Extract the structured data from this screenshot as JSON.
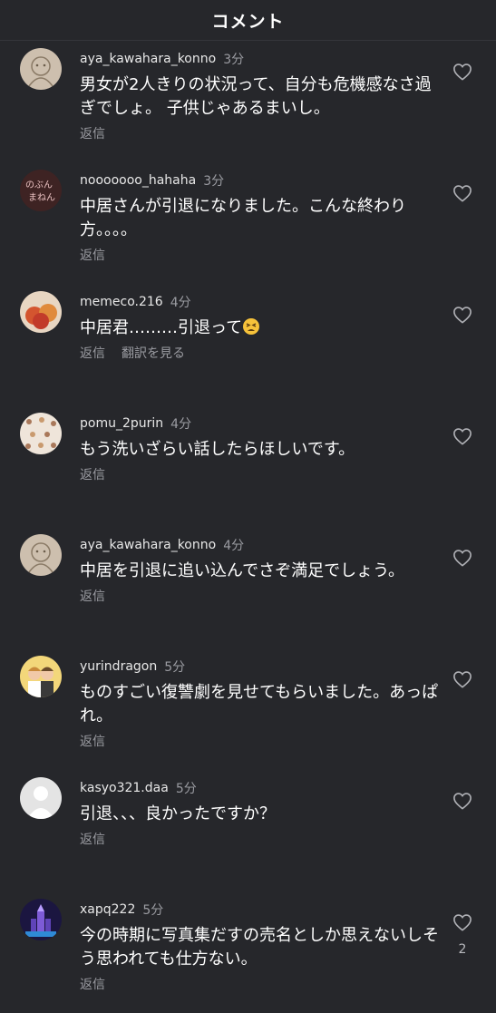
{
  "header": {
    "title": "コメント"
  },
  "comments": [
    {
      "username": "aya_kawahara_konno",
      "time": "3分",
      "text": "男女が2人きりの状況って、自分も危機感なさ過ぎでしょ。 子供じゃあるまいし。",
      "reply": "返信",
      "avatar": "sketch-avatar",
      "avatar_color": "#c7b7a2"
    },
    {
      "username": "nooooooo_hahaha",
      "time": "3分",
      "text": "中居さんが引退になりました。こんな終わり方。。。。",
      "reply": "返信",
      "avatar": "chalkboard-avatar",
      "avatar_color": "#4b2a2a"
    },
    {
      "username": "memeco.216",
      "time": "4分",
      "text": "中居君………引退って",
      "reply": "返信",
      "translate": "翻訳を見る",
      "avatar": "fruit-avatar",
      "avatar_color": "#c96a3a",
      "emoji": "tired-face-emoji"
    },
    {
      "username": "pomu_2purin",
      "time": "4分",
      "text": "もう洗いざらい話したらほしいです。",
      "reply": "返信",
      "avatar": "pattern-avatar",
      "avatar_color": "#eadfd2"
    },
    {
      "username": "aya_kawahara_konno",
      "time": "4分",
      "text": "中居を引退に追い込んでさぞ満足でしょう。",
      "reply": "返信",
      "avatar": "sketch-avatar",
      "avatar_color": "#c7b7a2"
    },
    {
      "username": "yurindragon",
      "time": "5分",
      "text": "ものすごい復讐劇を見せてもらいました。あっぱれ。",
      "reply": "返信",
      "avatar": "photo-avatar",
      "avatar_color": "#f0cf6a"
    },
    {
      "username": "kasyo321.daa",
      "time": "5分",
      "text": "引退、、、良かったですか？",
      "reply": "返信",
      "avatar": "default-user-avatar",
      "avatar_color": "#e6e6e6"
    },
    {
      "username": "xapq222",
      "time": "5分",
      "text": "今の時期に写真集だすの売名としか思えないしそう思われても仕方ない。",
      "reply": "返信",
      "like_count": "2",
      "avatar": "castle-avatar",
      "avatar_color": "#3b2a7a"
    }
  ]
}
